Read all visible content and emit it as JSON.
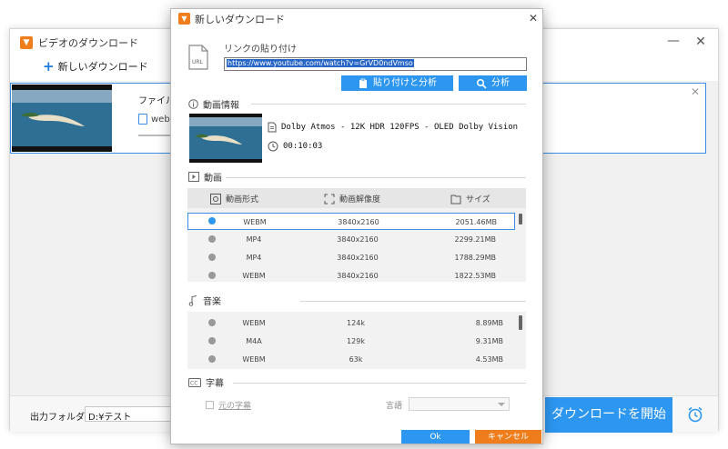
{
  "background_window": {
    "app_icon": "video-download-icon",
    "title": "ビデオのダウンロード",
    "new_download": "新しいダウンロード",
    "item": {
      "file_name_label": "ファイル名:",
      "format": "webm"
    },
    "output_folder_label": "出力フォルダ：",
    "output_folder_value": "D:¥テスト",
    "start_download": "ダウンロードを開始",
    "alarm_icon": "alarm-clock-icon"
  },
  "dialog": {
    "title": "新しいダウンロード",
    "paste_link_label": "リンクの貼り付け",
    "url_value": "https://www.youtube.com/watch?v=GrVD0ndVmso",
    "paste_analyze": "貼り付けと分析",
    "analyze": "分析",
    "video_info_heading": "動画情報",
    "video_title": "Dolby Atmos - 12K HDR 120FPS - OLED Dolby Vision",
    "duration": "00:10:03",
    "video_heading": "動画",
    "video_columns": [
      "動画形式",
      "動画解像度",
      "サイズ"
    ],
    "video_rows": [
      {
        "format": "WEBM",
        "resolution": "3840x2160",
        "size": "2051.46MB",
        "selected": true
      },
      {
        "format": "MP4",
        "resolution": "3840x2160",
        "size": "2299.21MB",
        "selected": false
      },
      {
        "format": "MP4",
        "resolution": "3840x2160",
        "size": "1788.29MB",
        "selected": false
      },
      {
        "format": "WEBM",
        "resolution": "3840x2160",
        "size": "1822.53MB",
        "selected": false
      }
    ],
    "audio_heading": "音楽",
    "audio_rows": [
      {
        "format": "WEBM",
        "bitrate": "124k",
        "size": "8.89MB"
      },
      {
        "format": "M4A",
        "bitrate": "129k",
        "size": "9.31MB"
      },
      {
        "format": "WEBM",
        "bitrate": "63k",
        "size": "4.53MB"
      }
    ],
    "subtitle_heading": "字幕",
    "original_subtitle": "元の字幕",
    "language_label": "言語",
    "ok": "Ok",
    "cancel": "キャンセル"
  },
  "colors": {
    "accent_blue": "#2d96f0",
    "accent_orange": "#f07d1c"
  }
}
